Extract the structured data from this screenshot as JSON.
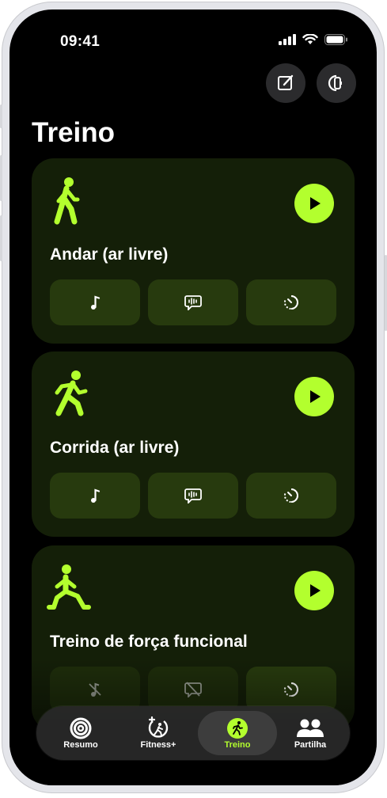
{
  "status": {
    "time": "09:41"
  },
  "page": {
    "title": "Treino"
  },
  "workouts": [
    {
      "title": "Andar (ar livre)"
    },
    {
      "title": "Corrida (ar livre)"
    },
    {
      "title": "Treino de força funcional"
    }
  ],
  "tabs": [
    {
      "label": "Resumo",
      "icon": "rings-icon"
    },
    {
      "label": "Fitness+",
      "icon": "fitness-plus-icon"
    },
    {
      "label": "Treino",
      "icon": "runner-icon",
      "selected": true
    },
    {
      "label": "Partilha",
      "icon": "people-icon"
    }
  ],
  "colors": {
    "accent": "#b3ff2e",
    "card": "#141f08",
    "action_bg": "#273a0e"
  }
}
